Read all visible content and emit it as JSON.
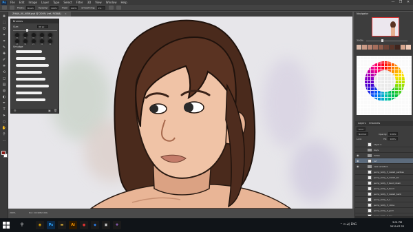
{
  "app": {
    "logo_text": "Ps",
    "menu": [
      "File",
      "Edit",
      "Image",
      "Layer",
      "Type",
      "Select",
      "Filter",
      "3D",
      "View",
      "Window",
      "Help"
    ],
    "window_controls": [
      "—",
      "❐",
      "✕"
    ]
  },
  "options_bar": {
    "tool_label": "",
    "mode_label": "Mode:",
    "mode_value": "Brush",
    "opacity_label": "Opacity:",
    "opacity_value": "100%",
    "flow_label": "Flow:",
    "flow_value": "100%",
    "smoothing_label": "Smoothing:",
    "smoothing_value": "0%"
  },
  "document": {
    "tab_title": "ZHAN_00_NEW.psd @ 200% (ref, RGB/8)",
    "close_glyph": "×"
  },
  "brush_panel": {
    "title": "Brushes",
    "size_label": "Size:",
    "size_value": "40 px",
    "tip_sizes": [
      "30",
      "30",
      "30",
      "25",
      "25",
      "25",
      "36",
      "25",
      "36",
      "36"
    ],
    "folder_name": "Smudge",
    "stroke_count": 8
  },
  "toolbar": {
    "tools": [
      "move-icon",
      "marquee-icon",
      "lasso-icon",
      "magic-wand-icon",
      "crop-icon",
      "eyedropper-icon",
      "healing-icon",
      "brush-icon",
      "stamp-icon",
      "history-brush-icon",
      "eraser-icon",
      "gradient-icon",
      "blur-icon",
      "dodge-icon",
      "pen-icon",
      "type-icon",
      "path-select-icon",
      "shape-icon",
      "hand-icon",
      "zoom-icon",
      "more-icon"
    ],
    "glyphs": [
      "✥",
      "⬚",
      "ʘ",
      "✦",
      "⌗",
      "✎",
      "✚",
      "✐",
      "⎈",
      "⟲",
      "◻",
      "▤",
      "◍",
      "◐",
      "✒",
      "T",
      "➤",
      "▭",
      "✋",
      "⚲",
      "…"
    ],
    "foreground_color": "#8a1a14",
    "background_color": "#ffffff"
  },
  "navigator": {
    "tab_label": "Navigator",
    "zoom_value": "200%"
  },
  "swatch_colors": [
    "#d9b7a6",
    "#c99a86",
    "#b98472",
    "#a66e5c",
    "#8e5b4a",
    "#6e4437",
    "#5a3428",
    "#3f241c",
    "#d8a68e",
    "#efc9b5"
  ],
  "layers_panel": {
    "tabs": [
      "Layers",
      "Channels"
    ],
    "kind_label": "Kind",
    "blend_mode": "Normal",
    "opacity_label": "Opacity:",
    "opacity_value": "100%",
    "lock_label": "Lock:",
    "fill_label": "Fill:",
    "fill_value": "100%",
    "layers": [
      {
        "name": "Layer 2",
        "type": "layer",
        "visible": false,
        "selected": false
      },
      {
        "name": "boys",
        "type": "group",
        "visible": false,
        "selected": false
      },
      {
        "name": "ladies",
        "type": "group",
        "visible": true,
        "selected": false
      },
      {
        "name": "ref",
        "type": "layer",
        "visible": true,
        "selected": true
      },
      {
        "name": "new sensitive",
        "type": "group",
        "visible": true,
        "selected": false
      },
      {
        "name": "jenny_body_3_naked_panties",
        "type": "layer",
        "visible": false,
        "selected": false
      },
      {
        "name": "jenny_body_3_naked_bk",
        "type": "layer",
        "visible": false,
        "selected": false
      },
      {
        "name": "jenny_body_3_bend_down",
        "type": "layer",
        "visible": false,
        "selected": false
      },
      {
        "name": "jenny_body_3_bend",
        "type": "layer",
        "visible": false,
        "selected": false
      },
      {
        "name": "jenny_body_3_naked_back",
        "type": "layer",
        "visible": false,
        "selected": false
      },
      {
        "name": "jenny_body_3_s...",
        "type": "layer",
        "visible": false,
        "selected": false
      },
      {
        "name": "jenny_body_3_clone",
        "type": "layer",
        "visible": false,
        "selected": false
      },
      {
        "name": "jenny_body_3_gold",
        "type": "layer",
        "visible": false,
        "selected": false
      },
      {
        "name": "jenny_body_3_bra",
        "type": "layer",
        "visible": false,
        "selected": false
      }
    ]
  },
  "status_bar": {
    "zoom": "200%",
    "doc_size": "Doc: 94.9M/2.46G"
  },
  "taskbar": {
    "search_glyph": "⚲",
    "apps": [
      {
        "name": "chrome",
        "label": "◉",
        "bg": "#1b1b1b",
        "fg": "#f4b400"
      },
      {
        "name": "photoshop",
        "label": "Ps",
        "bg": "#0b2a4a",
        "fg": "#31a8ff"
      },
      {
        "name": "explorer",
        "label": "▬",
        "bg": "#1b1b1b",
        "fg": "#e8b83a"
      },
      {
        "name": "illustrator",
        "label": "Ai",
        "bg": "#2e1a00",
        "fg": "#ff9a00"
      },
      {
        "name": "app-red",
        "label": "●",
        "bg": "#1b1b1b",
        "fg": "#d33"
      },
      {
        "name": "app-blue",
        "label": "◆",
        "bg": "#1b1b1b",
        "fg": "#2b7de9"
      },
      {
        "name": "app-white",
        "label": "▣",
        "bg": "#1b1b1b",
        "fg": "#ddd"
      },
      {
        "name": "app-purple",
        "label": "✚",
        "bg": "#1b1b1b",
        "fg": "#a36bd9"
      }
    ],
    "tray": "⌃  ⊡  ◂))  ENG",
    "time": "3:01 PM",
    "date": "2019-07-22"
  }
}
